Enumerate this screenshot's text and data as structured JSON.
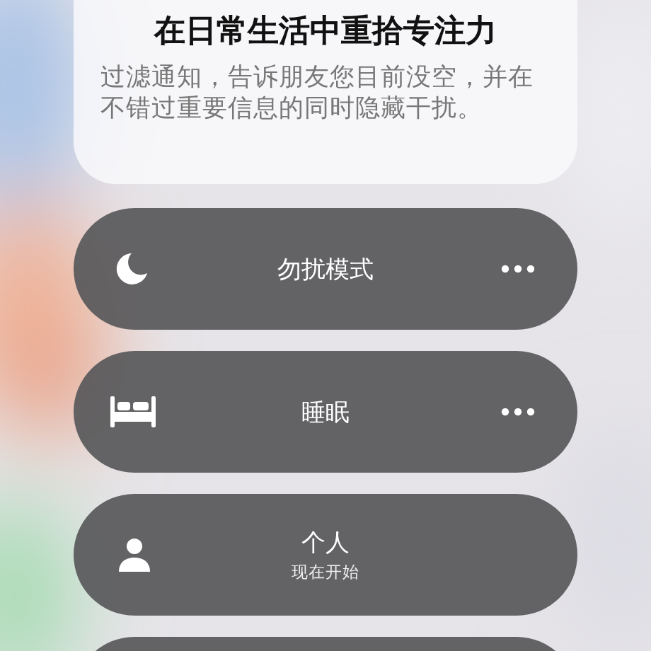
{
  "header": {
    "title": "在日常生活中重拾专注力",
    "description": "过滤通知，告诉朋友您目前没空，并在不错过重要信息的同时隐藏干扰。"
  },
  "focus_modes": [
    {
      "kind": "moon",
      "label": "勿扰模式",
      "has_more": true
    },
    {
      "kind": "bed",
      "label": "睡眠",
      "has_more": true
    },
    {
      "kind": "person",
      "label": "个人",
      "subtitle": "现在开始",
      "has_more": false
    }
  ]
}
